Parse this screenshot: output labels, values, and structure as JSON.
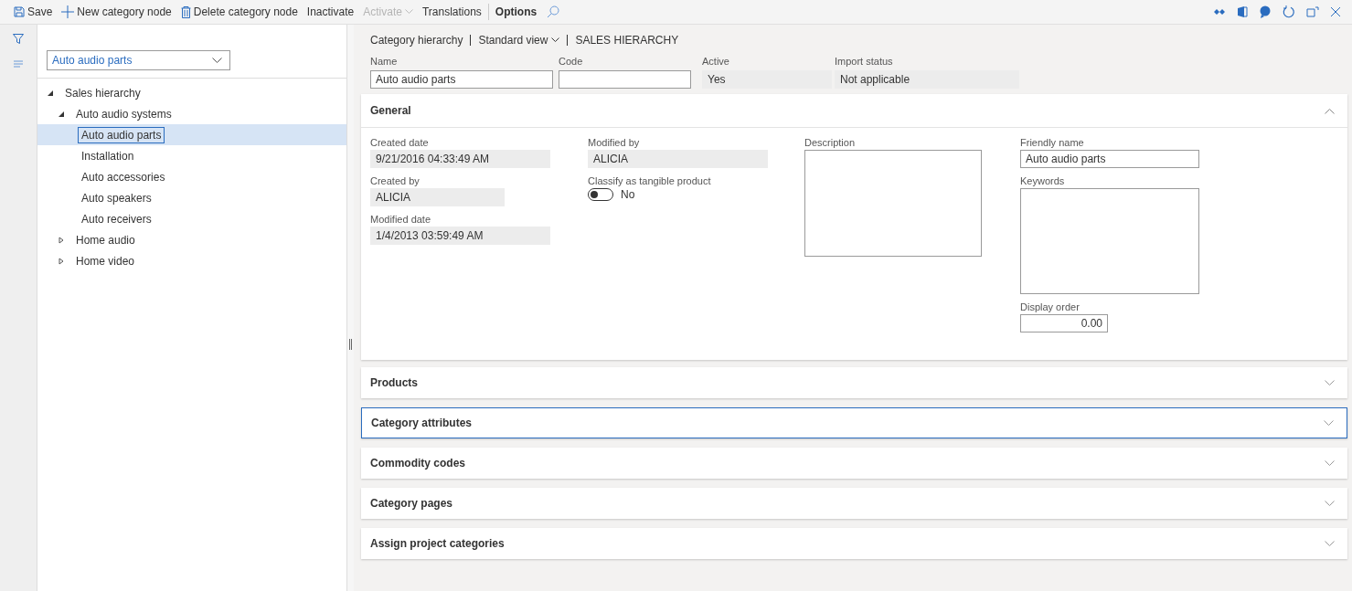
{
  "toolbar": {
    "items": [
      {
        "kind": "save",
        "label": "Save",
        "disabled": false
      },
      {
        "kind": "new",
        "label": "New category node",
        "disabled": false
      },
      {
        "kind": "delete",
        "label": "Delete category node",
        "disabled": false
      },
      {
        "kind": "plain",
        "label": "Inactivate",
        "disabled": false
      },
      {
        "kind": "dropdown",
        "label": "Activate",
        "disabled": true
      },
      {
        "kind": "plain",
        "label": "Translations",
        "disabled": false
      },
      {
        "kind": "bold",
        "label": "Options",
        "disabled": false
      }
    ]
  },
  "hierarchy_select": {
    "value": "Auto audio parts"
  },
  "tree": [
    {
      "label": "Sales hierarchy",
      "expanded": true,
      "selected": false,
      "children": [
        {
          "label": "Auto audio systems",
          "expanded": true,
          "selected": false,
          "children": [
            {
              "label": "Auto audio parts",
              "selected": true
            },
            {
              "label": "Installation",
              "selected": false
            },
            {
              "label": "Auto accessories",
              "selected": false
            },
            {
              "label": "Auto speakers",
              "selected": false
            },
            {
              "label": "Auto receivers",
              "selected": false
            }
          ]
        },
        {
          "label": "Home audio",
          "expanded": false,
          "selected": false
        },
        {
          "label": "Home video",
          "expanded": false,
          "selected": false
        }
      ]
    }
  ],
  "breadcrumb": {
    "form": "Category hierarchy",
    "view": "Standard view",
    "record": "SALES HIERARCHY"
  },
  "header_fields": [
    {
      "label": "Name",
      "value": "Auto audio parts",
      "kind": "input"
    },
    {
      "label": "Code",
      "kind": "input"
    },
    {
      "label": "Active",
      "value": "Yes",
      "kind": "readonly"
    },
    {
      "label": "Import status",
      "value": "Not applicable",
      "kind": "readonly"
    }
  ],
  "general": {
    "title": "General",
    "expanded": true,
    "created_date": {
      "label": "Created date",
      "value": "9/21/2016 04:33:49 AM"
    },
    "created_by": {
      "label": "Created by",
      "value": "ALICIA"
    },
    "modified_date": {
      "label": "Modified date",
      "value": "1/4/2013 03:59:49 AM"
    },
    "modified_by": {
      "label": "Modified by",
      "value": "ALICIA"
    },
    "tangible": {
      "label": "Classify as tangible product",
      "on": false,
      "value": "No"
    },
    "description": {
      "label": "Description"
    },
    "friendly_name": {
      "label": "Friendly name",
      "value": "Auto audio parts"
    },
    "keywords": {
      "label": "Keywords"
    },
    "display_order": {
      "label": "Display order",
      "value": "0.00"
    }
  },
  "sections": [
    {
      "title": "Products",
      "expanded": false,
      "selected": false
    },
    {
      "title": "Category attributes",
      "expanded": false,
      "selected": true
    },
    {
      "title": "Commodity codes",
      "expanded": false,
      "selected": false
    },
    {
      "title": "Category pages",
      "expanded": false,
      "selected": false
    },
    {
      "title": "Assign project categories",
      "expanded": false,
      "selected": false
    }
  ]
}
